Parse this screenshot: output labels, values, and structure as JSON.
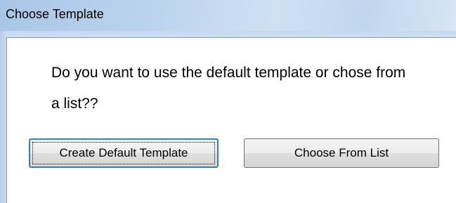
{
  "window": {
    "title": "Choose Template"
  },
  "dialog": {
    "message": "Do you want to use the default template or chose from a list??",
    "buttons": {
      "create_default_label": "Create Default Template",
      "choose_from_list_label": "Choose From List"
    }
  }
}
